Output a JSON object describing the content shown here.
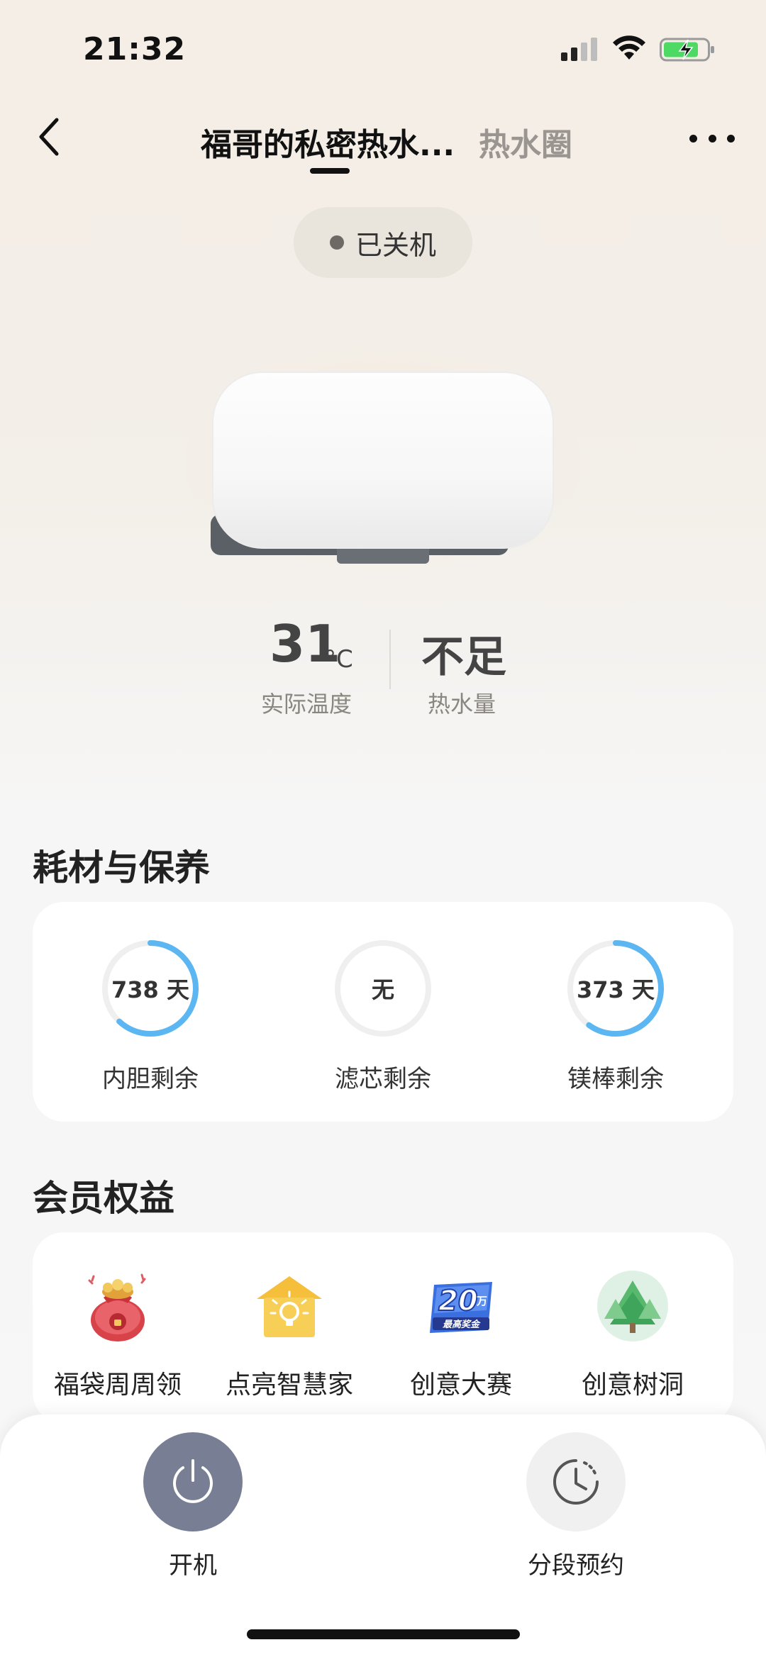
{
  "status_bar": {
    "time": "21:32"
  },
  "nav": {
    "tabs": [
      {
        "label": "福哥的私密热水...",
        "active": true
      },
      {
        "label": "热水圈",
        "active": false
      }
    ]
  },
  "device": {
    "power_status": "已关机",
    "actual_temperature": "31",
    "temperature_unit": "°C",
    "actual_temperature_label": "实际温度",
    "hot_water_amount": "不足",
    "hot_water_amount_label": "热水量"
  },
  "consumables": {
    "title": "耗材与保养",
    "items": [
      {
        "value": "738 天",
        "label": "内胆剩余",
        "ring_fraction": 0.62
      },
      {
        "value": "无",
        "label": "滤芯剩余",
        "ring_fraction": 0
      },
      {
        "value": "373 天",
        "label": "镁棒剩余",
        "ring_fraction": 0.6
      }
    ]
  },
  "benefits": {
    "title": "会员权益",
    "items": [
      {
        "label": "福袋周周领",
        "icon": "lucky-bag-icon"
      },
      {
        "label": "点亮智慧家",
        "icon": "smart-home-bulb-icon"
      },
      {
        "label": "创意大赛",
        "icon": "prize-200k-icon"
      },
      {
        "label": "创意树洞",
        "icon": "tree-hollow-icon"
      }
    ],
    "prize_badge": {
      "number": "20",
      "unit": "万",
      "caption": "最高奖金"
    }
  },
  "controls": {
    "power_label": "开机",
    "schedule_label": "分段预约"
  },
  "colors": {
    "ring_active": "#5bb6f1",
    "ring_track": "#efefef",
    "power_button": "#787f95"
  }
}
